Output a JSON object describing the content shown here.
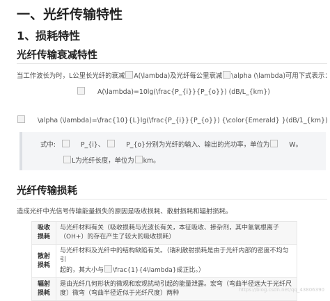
{
  "heading1": "一、光纤传输特性",
  "heading2": "1、损耗特性",
  "section1": {
    "title": "光纤传输衰减特性",
    "intro": {
      "a": "当工作波长为时，L公里长光纤的衰减",
      "b": "A(\\lambda)及光纤每公里衰减",
      "c": "\\alpha (\\lambda)可用下式表示："
    },
    "formula1": "A(\\lambda)=10lg(\\frac{P_{i}}{P_{o}}) (dB/L_{km})",
    "formula2": "\\alpha (\\lambda)=\\frac{10}{L}lg(\\frac{P_{i}}{P_{o}}) {\\color{Emerald} }(dB/1_{km})",
    "note": {
      "a": "式中:",
      "b": "P_{i}、",
      "c": "P_{o}分别为光纤的输入、输出的光功率，单位为",
      "d": "W。",
      "e": "L为光纤长度，单位为",
      "f": "km。"
    }
  },
  "section2": {
    "title": "光纤传输损耗",
    "intro": "造成光纤中光信号传输能量损失的原因是吸收损耗、散射损耗和辐射损耗。",
    "table": [
      {
        "label_l1": "吸收",
        "label_l2": "损耗",
        "line1": "与光纤材料有关（吸收损耗与光波长有关，本征吸收、掺杂剂，其中氢氧根离子",
        "line2": "（OH+）的存在产生了较大的吸收损耗）"
      },
      {
        "label_l1": "散射",
        "label_l2": "损耗",
        "line1": "与光纤材料及光纤中的结构缺陷有关。（瑞利散射损耗是由于光纤内部的密度不均匀引",
        "line2a": "起的，其大小与",
        "line2b": "\\frac{1}{4\\lambda}成正比。）"
      },
      {
        "label_l1": "辐射",
        "label_l2": "损耗",
        "line1": "是由光纤几何形状的微观和宏观扰动引起的能量泄露。宏弯（弯曲半径远大于光纤尺",
        "line2": "度）微弯（弯曲半径近似于光纤尺度）两种"
      }
    ]
  },
  "watermark": "https://blog.csdn.net/qq_43806390"
}
